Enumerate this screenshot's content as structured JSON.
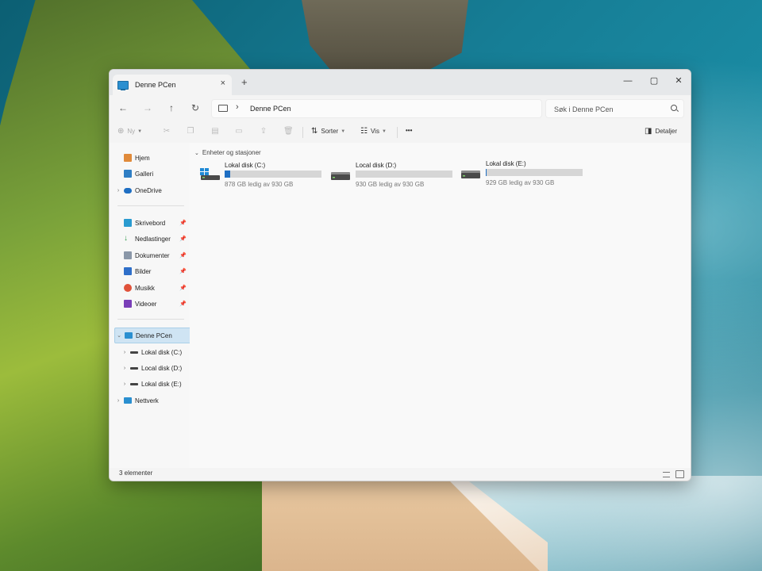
{
  "window": {
    "tab_title": "Denne PCen",
    "tab_close": "×",
    "new_tab": "+",
    "minimize": "—",
    "maximize": "▢",
    "close": "✕"
  },
  "address": {
    "breadcrumb_sep": "›",
    "crumb": "Denne PCen",
    "search_placeholder": "Søk i Denne PCen"
  },
  "commands": {
    "new_label": "Ny",
    "sort_label": "Sorter",
    "view_label": "Vis",
    "more_label": "•••",
    "details_label": "Detaljer"
  },
  "sidebar": {
    "items": [
      {
        "label": "Hjem",
        "icon": "home-icon"
      },
      {
        "label": "Galleri",
        "icon": "gallery-icon"
      },
      {
        "label": "OneDrive",
        "icon": "onedrive-icon"
      },
      {
        "label": "Skrivebord",
        "icon": "desktop-icon"
      },
      {
        "label": "Nedlastinger",
        "icon": "downloads-icon"
      },
      {
        "label": "Dokumenter",
        "icon": "documents-icon"
      },
      {
        "label": "Bilder",
        "icon": "pictures-icon"
      },
      {
        "label": "Musikk",
        "icon": "music-icon"
      },
      {
        "label": "Videoer",
        "icon": "videos-icon"
      },
      {
        "label": "Denne PCen",
        "icon": "computer-icon"
      },
      {
        "label": "Lokal disk (C:)",
        "icon": "drive-icon"
      },
      {
        "label": "Local disk (D:)",
        "icon": "drive-icon"
      },
      {
        "label": "Lokal disk (E:)",
        "icon": "drive-icon"
      },
      {
        "label": "Nettverk",
        "icon": "network-icon"
      }
    ]
  },
  "content": {
    "group_title": "Enheter og stasjoner",
    "drives": [
      {
        "name": "Lokal disk (C:)",
        "free_text": "878 GB ledig av 930 GB",
        "used_fraction": 0.06
      },
      {
        "name": "Local disk (D:)",
        "free_text": "930 GB ledig av 930 GB",
        "used_fraction": 0.0
      },
      {
        "name": "Lokal disk (E:)",
        "free_text": "929 GB ledig av 930 GB",
        "used_fraction": 0.001
      }
    ]
  },
  "status": {
    "item_count": "3 elementer"
  },
  "colors": {
    "accent": "#1f6fc3",
    "selection": "#cfe4f3"
  }
}
